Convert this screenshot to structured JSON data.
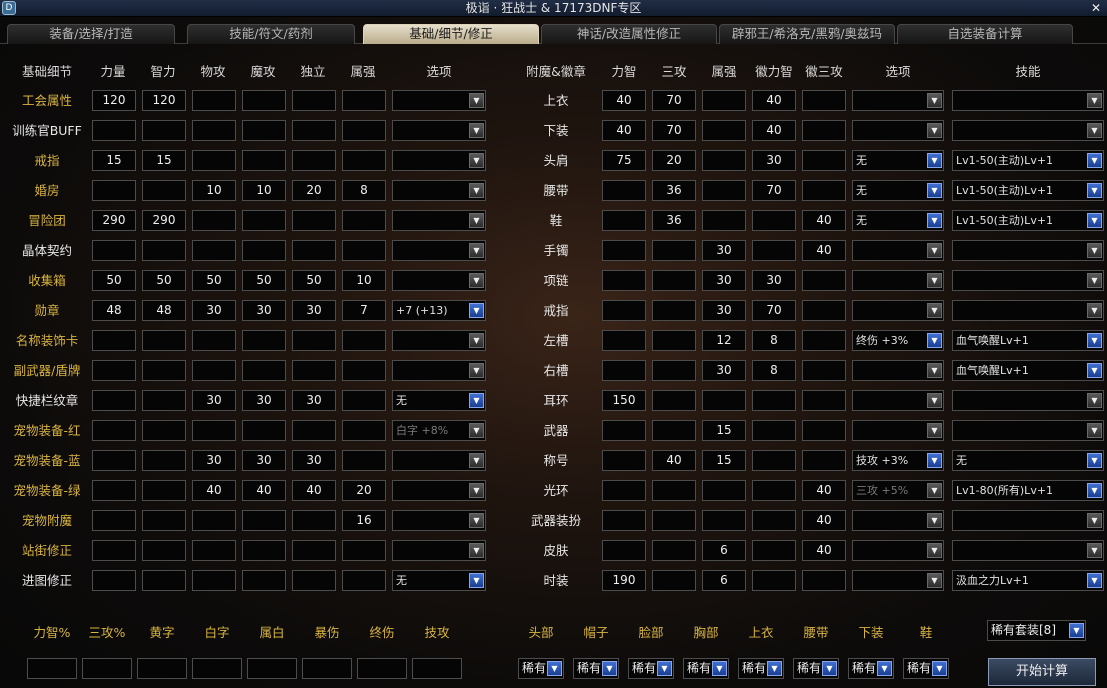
{
  "window": {
    "title": "极诣 · 狂战士 & 17173DNF专区",
    "close": "✕",
    "icon": "D"
  },
  "tabs": [
    "装备/选择/打造",
    "技能/符文/药剂",
    "基础/细节/修正",
    "神话/改造属性修正",
    "辟邪王/希洛克/黑鸦/奥兹玛",
    "自选装备计算"
  ],
  "active_tab": 2,
  "left": {
    "headers": [
      "基础细节",
      "力量",
      "智力",
      "物攻",
      "魔攻",
      "独立",
      "属强",
      "选项"
    ],
    "rows": [
      {
        "label": "工会属性",
        "tone": "y",
        "vals": [
          "120",
          "120",
          "",
          "",
          "",
          ""
        ],
        "opt": "",
        "blue": false,
        "dis": false
      },
      {
        "label": "训练官BUFF",
        "tone": "w",
        "vals": [
          "",
          "",
          "",
          "",
          "",
          ""
        ],
        "opt": "",
        "blue": false,
        "dis": false
      },
      {
        "label": "戒指",
        "tone": "y",
        "vals": [
          "15",
          "15",
          "",
          "",
          "",
          ""
        ],
        "opt": "",
        "blue": false,
        "dis": false
      },
      {
        "label": "婚房",
        "tone": "y",
        "vals": [
          "",
          "",
          "10",
          "10",
          "20",
          "8"
        ],
        "opt": "",
        "blue": false,
        "dis": false
      },
      {
        "label": "冒险团",
        "tone": "y",
        "vals": [
          "290",
          "290",
          "",
          "",
          "",
          ""
        ],
        "opt": "",
        "blue": false,
        "dis": false
      },
      {
        "label": "晶体契约",
        "tone": "w",
        "vals": [
          "",
          "",
          "",
          "",
          "",
          ""
        ],
        "opt": "",
        "blue": false,
        "dis": false
      },
      {
        "label": "收集箱",
        "tone": "y",
        "vals": [
          "50",
          "50",
          "50",
          "50",
          "50",
          "10"
        ],
        "opt": "",
        "blue": false,
        "dis": false
      },
      {
        "label": "勋章",
        "tone": "y",
        "vals": [
          "48",
          "48",
          "30",
          "30",
          "30",
          "7"
        ],
        "opt": "+7 (+13)",
        "blue": true,
        "dis": false
      },
      {
        "label": "名称装饰卡",
        "tone": "y",
        "vals": [
          "",
          "",
          "",
          "",
          "",
          ""
        ],
        "opt": "",
        "blue": false,
        "dis": false
      },
      {
        "label": "副武器/盾牌",
        "tone": "y",
        "vals": [
          "",
          "",
          "",
          "",
          "",
          ""
        ],
        "opt": "",
        "blue": false,
        "dis": false
      },
      {
        "label": "快捷栏纹章",
        "tone": "w",
        "vals": [
          "",
          "",
          "30",
          "30",
          "30",
          ""
        ],
        "opt": "无",
        "blue": true,
        "dis": false
      },
      {
        "label": "宠物装备-红",
        "tone": "y",
        "vals": [
          "",
          "",
          "",
          "",
          "",
          ""
        ],
        "opt": "白字 +8%",
        "blue": false,
        "dis": true
      },
      {
        "label": "宠物装备-蓝",
        "tone": "y",
        "vals": [
          "",
          "",
          "30",
          "30",
          "30",
          ""
        ],
        "opt": "",
        "blue": false,
        "dis": false
      },
      {
        "label": "宠物装备-绿",
        "tone": "y",
        "vals": [
          "",
          "",
          "40",
          "40",
          "40",
          "20"
        ],
        "opt": "",
        "blue": false,
        "dis": false
      },
      {
        "label": "宠物附魔",
        "tone": "y",
        "vals": [
          "",
          "",
          "",
          "",
          "",
          "16"
        ],
        "opt": "",
        "blue": false,
        "dis": false
      },
      {
        "label": "站街修正",
        "tone": "y",
        "vals": [
          "",
          "",
          "",
          "",
          "",
          ""
        ],
        "opt": "",
        "blue": false,
        "dis": false
      },
      {
        "label": "进图修正",
        "tone": "w",
        "vals": [
          "",
          "",
          "",
          "",
          "",
          ""
        ],
        "opt": "无",
        "blue": true,
        "dis": false
      }
    ]
  },
  "right": {
    "headers": [
      "附魔&徽章",
      "力智",
      "三攻",
      "属强",
      "徽力智",
      "徽三攻",
      "选项",
      "技能"
    ],
    "rows": [
      {
        "label": "上衣",
        "vals": [
          "40",
          "70",
          "",
          "40",
          ""
        ],
        "opt": "",
        "oblue": false,
        "odis": false,
        "skill": "",
        "sblue": false
      },
      {
        "label": "下装",
        "vals": [
          "40",
          "70",
          "",
          "40",
          ""
        ],
        "opt": "",
        "oblue": false,
        "odis": false,
        "skill": "",
        "sblue": false
      },
      {
        "label": "头肩",
        "vals": [
          "75",
          "20",
          "",
          "30",
          ""
        ],
        "opt": "无",
        "oblue": true,
        "odis": false,
        "skill": "Lv1-50(主动)Lv+1",
        "sblue": true
      },
      {
        "label": "腰带",
        "vals": [
          "",
          "36",
          "",
          "70",
          ""
        ],
        "opt": "无",
        "oblue": true,
        "odis": false,
        "skill": "Lv1-50(主动)Lv+1",
        "sblue": true
      },
      {
        "label": "鞋",
        "vals": [
          "",
          "36",
          "",
          "",
          "40"
        ],
        "opt": "无",
        "oblue": true,
        "odis": false,
        "skill": "Lv1-50(主动)Lv+1",
        "sblue": true
      },
      {
        "label": "手镯",
        "vals": [
          "",
          "",
          "30",
          "",
          "40"
        ],
        "opt": "",
        "oblue": false,
        "odis": false,
        "skill": "",
        "sblue": false
      },
      {
        "label": "项链",
        "vals": [
          "",
          "",
          "30",
          "30",
          ""
        ],
        "opt": "",
        "oblue": false,
        "odis": false,
        "skill": "",
        "sblue": false
      },
      {
        "label": "戒指",
        "vals": [
          "",
          "",
          "30",
          "70",
          ""
        ],
        "opt": "",
        "oblue": false,
        "odis": false,
        "skill": "",
        "sblue": false
      },
      {
        "label": "左槽",
        "vals": [
          "",
          "",
          "12",
          "8",
          ""
        ],
        "opt": "终伤 +3%",
        "oblue": true,
        "odis": false,
        "skill": "血气唤醒Lv+1",
        "sblue": true
      },
      {
        "label": "右槽",
        "vals": [
          "",
          "",
          "30",
          "8",
          ""
        ],
        "opt": "",
        "oblue": false,
        "odis": false,
        "skill": "血气唤醒Lv+1",
        "sblue": true
      },
      {
        "label": "耳环",
        "vals": [
          "150",
          "",
          "",
          "",
          ""
        ],
        "opt": "",
        "oblue": false,
        "odis": false,
        "skill": "",
        "sblue": false
      },
      {
        "label": "武器",
        "vals": [
          "",
          "",
          "15",
          "",
          ""
        ],
        "opt": "",
        "oblue": false,
        "odis": false,
        "skill": "",
        "sblue": false
      },
      {
        "label": "称号",
        "vals": [
          "",
          "40",
          "15",
          "",
          ""
        ],
        "opt": "技攻 +3%",
        "oblue": true,
        "odis": false,
        "skill": "无",
        "sblue": true
      },
      {
        "label": "光环",
        "vals": [
          "",
          "",
          "",
          "",
          "40"
        ],
        "opt": "三攻 +5%",
        "oblue": false,
        "odis": true,
        "skill": "Lv1-80(所有)Lv+1",
        "sblue": true
      },
      {
        "label": "武器装扮",
        "vals": [
          "",
          "",
          "",
          "",
          "40"
        ],
        "opt": "",
        "oblue": false,
        "odis": false,
        "skill": "",
        "sblue": false
      },
      {
        "label": "皮肤",
        "vals": [
          "",
          "",
          "6",
          "",
          "40"
        ],
        "opt": "",
        "oblue": false,
        "odis": false,
        "skill": "",
        "sblue": false
      },
      {
        "label": "时装",
        "vals": [
          "190",
          "",
          "6",
          "",
          ""
        ],
        "opt": "",
        "oblue": false,
        "odis": false,
        "skill": "汲血之力Lv+1",
        "sblue": true
      }
    ]
  },
  "bottom": {
    "stat_labels": [
      "力智%",
      "三攻%",
      "黄字",
      "白字",
      "属白",
      "暴伤",
      "终伤",
      "技攻"
    ],
    "slot_labels": [
      "头部",
      "帽子",
      "脸部",
      "胸部",
      "上衣",
      "腰带",
      "下装",
      "鞋"
    ],
    "rarity": "稀有",
    "set_select": "稀有套装[8]",
    "calc_button": "开始计算"
  }
}
